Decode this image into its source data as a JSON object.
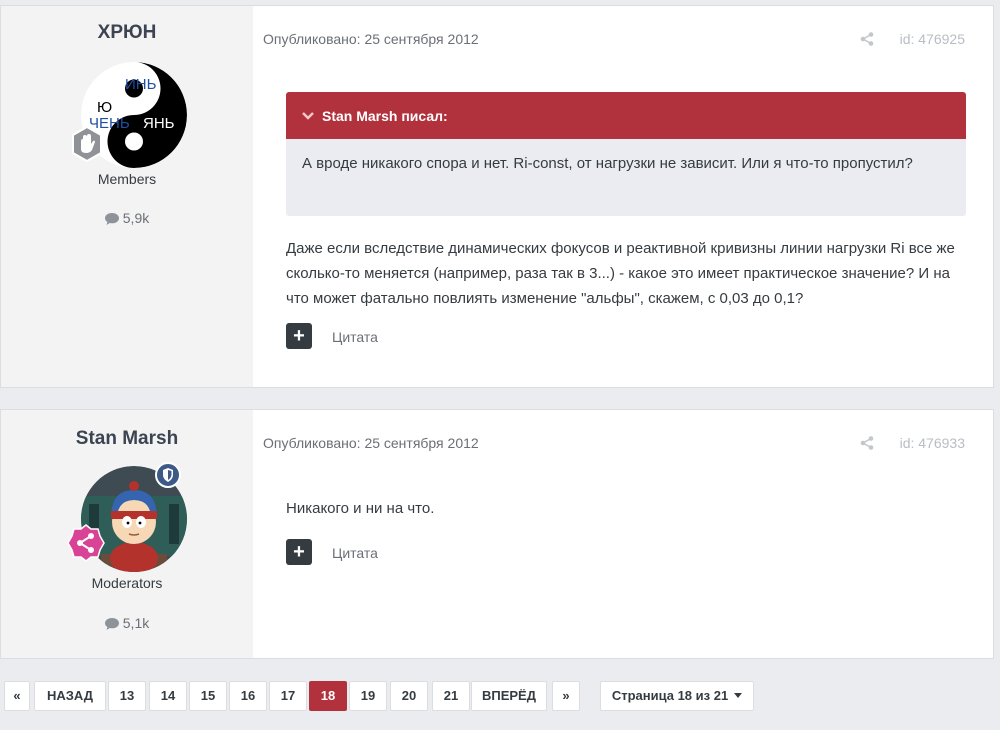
{
  "posts": [
    {
      "author": "ХРЮН",
      "avatar_text": [
        "ИНЬ",
        "ЯНЬ",
        "Ю",
        "ЧЕНЬ"
      ],
      "group": "Members",
      "count": "5,9k",
      "date": "Опубликовано: 25 сентября 2012",
      "post_id": "id: 476925",
      "quote": {
        "author_label": "Stan Marsh писал:",
        "text": "А вроде никакого спора и нет. Ri-const, от нагрузки не зависит. Или я что-то пропустил?"
      },
      "body": "Даже если вследствие динамических фокусов и реактивной кривизны линии нагрузки Ri все же сколько-то меняется (например, раза так в 3...) - какое это имеет практическое значение? И на что может фатально повлиять изменение \"альфы\", скажем, с 0,03 до 0,1?",
      "plus": "+",
      "quote_label": "Цитата"
    },
    {
      "author": "Stan Marsh",
      "group": "Moderators",
      "count": "5,1k",
      "date": "Опубликовано: 25 сентября 2012",
      "post_id": "id: 476933",
      "body": "Никакого и ни на что.",
      "plus": "+",
      "quote_label": "Цитата"
    }
  ],
  "pagination": {
    "first": "«",
    "prev": "НАЗАД",
    "pages": [
      "13",
      "14",
      "15",
      "16",
      "17",
      "18",
      "19",
      "20",
      "21"
    ],
    "current": "18",
    "next": "ВПЕРЁД",
    "last": "»",
    "page_label": "Страница 18 из 21"
  },
  "colors": {
    "accent": "#b1323c",
    "background": "#ebecf0",
    "author_panel": "#f3f3f4"
  }
}
